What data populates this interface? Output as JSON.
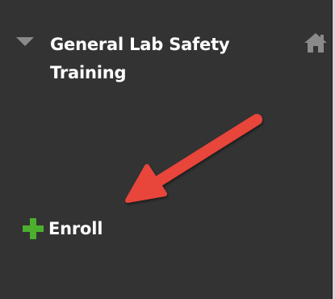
{
  "course": {
    "title_line1": "General Lab Safety",
    "title_line2": "Training"
  },
  "actions": {
    "enroll_label": "Enroll"
  },
  "icons": {
    "collapse": "caret-down-icon",
    "home": "home-icon",
    "enroll": "plus-icon",
    "annotation": "red-arrow"
  },
  "colors": {
    "panel_background": "#333333",
    "text": "#ffffff",
    "toggle": "#8a8a8a",
    "home_icon": "#8a8a8a",
    "plus": "#4caf2e",
    "arrow": "#e8443a"
  }
}
